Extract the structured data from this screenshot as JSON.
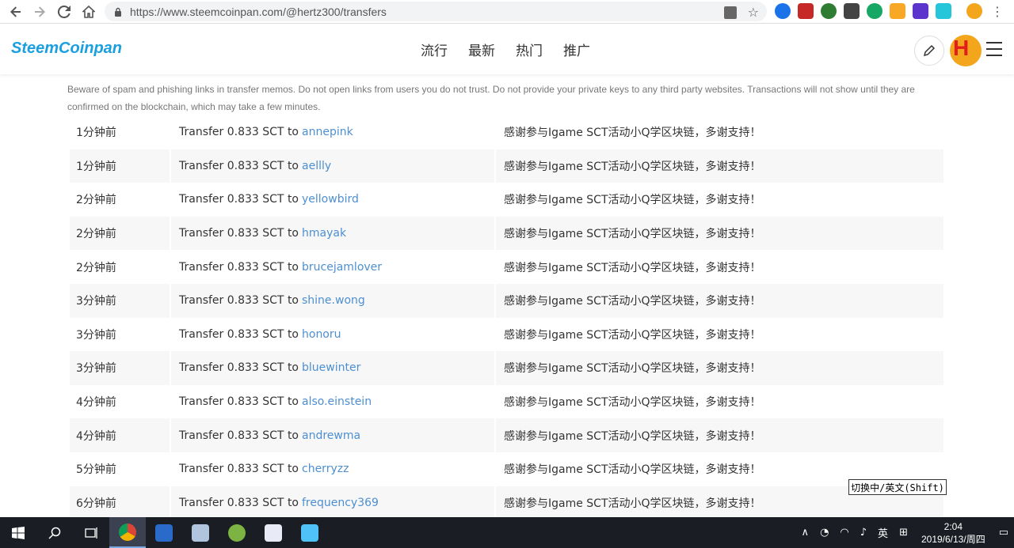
{
  "browser": {
    "url": "https://www.steemcoinpan.com/@hertz300/transfers"
  },
  "site": {
    "logo": "SteemCoinpan",
    "nav": [
      "流行",
      "最新",
      "热门",
      "推广"
    ],
    "avatar_letter": "H"
  },
  "warning": "Beware of spam and phishing links in transfer memos. Do not open links from users you do not trust. Do not provide your private keys to any third party websites. Transactions will not show until they are confirmed on the blockchain, which may take a few minutes.",
  "transfers": [
    {
      "time": "1分钟前",
      "prefix": "Transfer 0.833 SCT to",
      "to": "annepink",
      "memo": "感谢参与Igame SCT活动小Q学区块链，多谢支持！"
    },
    {
      "time": "1分钟前",
      "prefix": "Transfer 0.833 SCT to",
      "to": "aellly",
      "memo": "感谢参与Igame SCT活动小Q学区块链，多谢支持！"
    },
    {
      "time": "2分钟前",
      "prefix": "Transfer 0.833 SCT to",
      "to": "yellowbird",
      "memo": "感谢参与Igame SCT活动小Q学区块链，多谢支持！"
    },
    {
      "time": "2分钟前",
      "prefix": "Transfer 0.833 SCT to",
      "to": "hmayak",
      "memo": "感谢参与Igame SCT活动小Q学区块链，多谢支持！"
    },
    {
      "time": "2分钟前",
      "prefix": "Transfer 0.833 SCT to",
      "to": "brucejamlover",
      "memo": "感谢参与Igame SCT活动小Q学区块链，多谢支持！"
    },
    {
      "time": "3分钟前",
      "prefix": "Transfer 0.833 SCT to",
      "to": "shine.wong",
      "memo": "感谢参与Igame SCT活动小Q学区块链，多谢支持！"
    },
    {
      "time": "3分钟前",
      "prefix": "Transfer 0.833 SCT to",
      "to": "honoru",
      "memo": "感谢参与Igame SCT活动小Q学区块链，多谢支持！"
    },
    {
      "time": "3分钟前",
      "prefix": "Transfer 0.833 SCT to",
      "to": "bluewinter",
      "memo": "感谢参与Igame SCT活动小Q学区块链，多谢支持！"
    },
    {
      "time": "4分钟前",
      "prefix": "Transfer 0.833 SCT to",
      "to": "also.einstein",
      "memo": "感谢参与Igame SCT活动小Q学区块链，多谢支持！"
    },
    {
      "time": "4分钟前",
      "prefix": "Transfer 0.833 SCT to",
      "to": "andrewma",
      "memo": "感谢参与Igame SCT活动小Q学区块链，多谢支持！"
    },
    {
      "time": "5分钟前",
      "prefix": "Transfer 0.833 SCT to",
      "to": "cherryzz",
      "memo": "感谢参与Igame SCT活动小Q学区块链，多谢支持！"
    },
    {
      "time": "6分钟前",
      "prefix": "Transfer 0.833 SCT to",
      "to": "frequency369",
      "memo": "感谢参与Igame SCT活动小Q学区块链，多谢支持！"
    }
  ],
  "ime_tooltip": "切换中/英文(Shift)",
  "taskbar": {
    "ime_lang": "英",
    "time": "2:04",
    "date": "2019/6/13/周四"
  },
  "colors": {
    "brand": "#1a9fe0",
    "link": "#4d8fd0",
    "row_alt": "#f7f7f7"
  }
}
